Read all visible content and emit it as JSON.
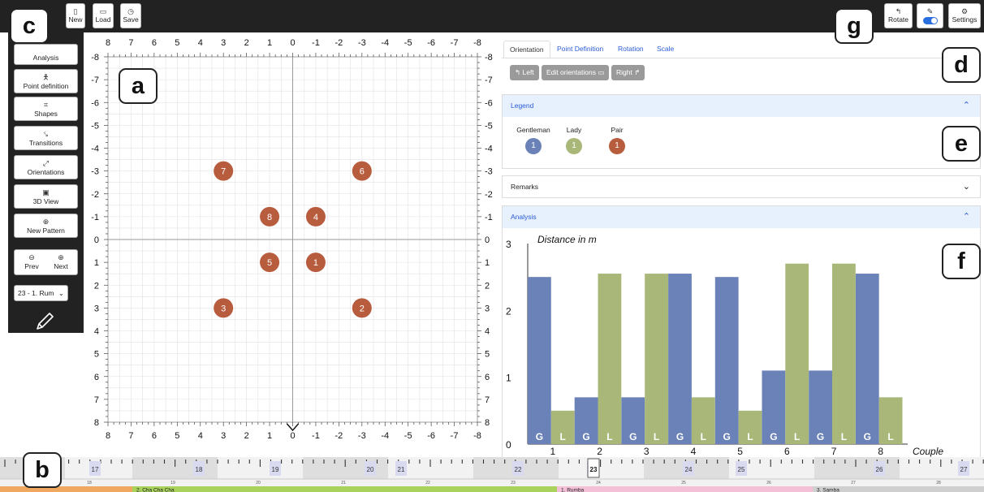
{
  "toolbar": {
    "buttons": [
      {
        "label": "New",
        "icon": "file-icon"
      },
      {
        "label": "Load",
        "icon": "folder-icon"
      },
      {
        "label": "Save",
        "icon": "save-icon"
      }
    ],
    "right_buttons": [
      {
        "label": "Rotate",
        "icon": "rotate-icon"
      },
      {
        "label": "",
        "icon": "pencil-toggle-icon"
      },
      {
        "label": "Settings",
        "icon": "gear-icon"
      }
    ]
  },
  "sidebar": {
    "items": [
      {
        "label": "Analysis",
        "icon": "analysis-icon"
      },
      {
        "label": "Point definition",
        "icon": "person-icon"
      },
      {
        "label": "Shapes",
        "icon": "shapes-icon"
      },
      {
        "label": "Transitions",
        "icon": "transitions-icon"
      },
      {
        "label": "Orientations",
        "icon": "orientations-icon"
      },
      {
        "label": "3D View",
        "icon": "cube-icon"
      },
      {
        "label": "New Pattern",
        "icon": "plus-circle-icon"
      }
    ],
    "prev_label": "Prev",
    "next_label": "Next",
    "select_value": "23 - 1. Rum"
  },
  "badges": {
    "a": "a",
    "b": "b",
    "c": "c",
    "d": "d",
    "e": "e",
    "f": "f",
    "g": "g"
  },
  "floor": {
    "x_ticks": [
      "8",
      "7",
      "6",
      "5",
      "4",
      "3",
      "2",
      "1",
      "0",
      "-1",
      "-2",
      "-3",
      "-4",
      "-5",
      "-6",
      "-7",
      "-8"
    ],
    "y_ticks": [
      "-8",
      "-7",
      "-6",
      "-5",
      "-4",
      "-3",
      "-2",
      "-1",
      "0",
      "1",
      "2",
      "3",
      "4",
      "5",
      "6",
      "7",
      "8"
    ],
    "couples": [
      {
        "label": "1",
        "x": -1,
        "y": 1
      },
      {
        "label": "2",
        "x": -3,
        "y": 3
      },
      {
        "label": "3",
        "x": 3,
        "y": 3
      },
      {
        "label": "4",
        "x": -1,
        "y": -1
      },
      {
        "label": "5",
        "x": 1,
        "y": 1
      },
      {
        "label": "6",
        "x": -3,
        "y": -3
      },
      {
        "label": "7",
        "x": 3,
        "y": -3
      },
      {
        "label": "8",
        "x": 1,
        "y": -1
      }
    ],
    "pair_color": "#b85c3e"
  },
  "panel": {
    "tabs": [
      "Orientation",
      "Point Definition",
      "Rotation",
      "Scale"
    ],
    "left_btn": "↰ Left",
    "edit_btn": "Edit orientations ▭",
    "right_btn": "Right ↱",
    "legend_title": "Legend",
    "legend": [
      {
        "label": "Gentleman",
        "value": "1",
        "color": "#6b82b8"
      },
      {
        "label": "Lady",
        "value": "1",
        "color": "#a9b878"
      },
      {
        "label": "Pair",
        "value": "1",
        "color": "#b85c3e"
      }
    ],
    "remarks_title": "Remarks",
    "analysis_title": "Analysis"
  },
  "chart_data": {
    "type": "bar",
    "title": "Distance in m",
    "xlabel": "Couple",
    "ylabel": "",
    "ylim": [
      0,
      3
    ],
    "yticks": [
      "0",
      "1",
      "2",
      "3"
    ],
    "categories": [
      "1",
      "2",
      "3",
      "4",
      "5",
      "6",
      "7",
      "8"
    ],
    "bar_letters": [
      "G",
      "L"
    ],
    "series": [
      {
        "name": "G",
        "color": "#6b82b8",
        "values": [
          2.5,
          0.7,
          0.7,
          2.55,
          2.5,
          1.1,
          1.1,
          2.55
        ]
      },
      {
        "name": "L",
        "color": "#a9b878",
        "values": [
          0.5,
          2.55,
          2.55,
          0.7,
          0.5,
          2.7,
          2.7,
          0.7
        ]
      }
    ]
  },
  "timeline": {
    "numbers": [
      "17",
      "18",
      "19",
      "20",
      "21",
      "22",
      "23",
      "24",
      "25",
      "26",
      "27"
    ],
    "small_numbers": [
      "18",
      "19",
      "20",
      "21",
      "22",
      "23",
      "24",
      "25",
      "26",
      "27",
      "28"
    ],
    "current": "23",
    "dances": [
      {
        "label": "",
        "color": "#f0a860"
      },
      {
        "label": "2. Cha Cha Cha",
        "color": "#a9d25c"
      },
      {
        "label": "1. Rumba",
        "color": "#f3c0d8"
      },
      {
        "label": "3. Samba",
        "color": "#cfcfcf"
      }
    ]
  }
}
